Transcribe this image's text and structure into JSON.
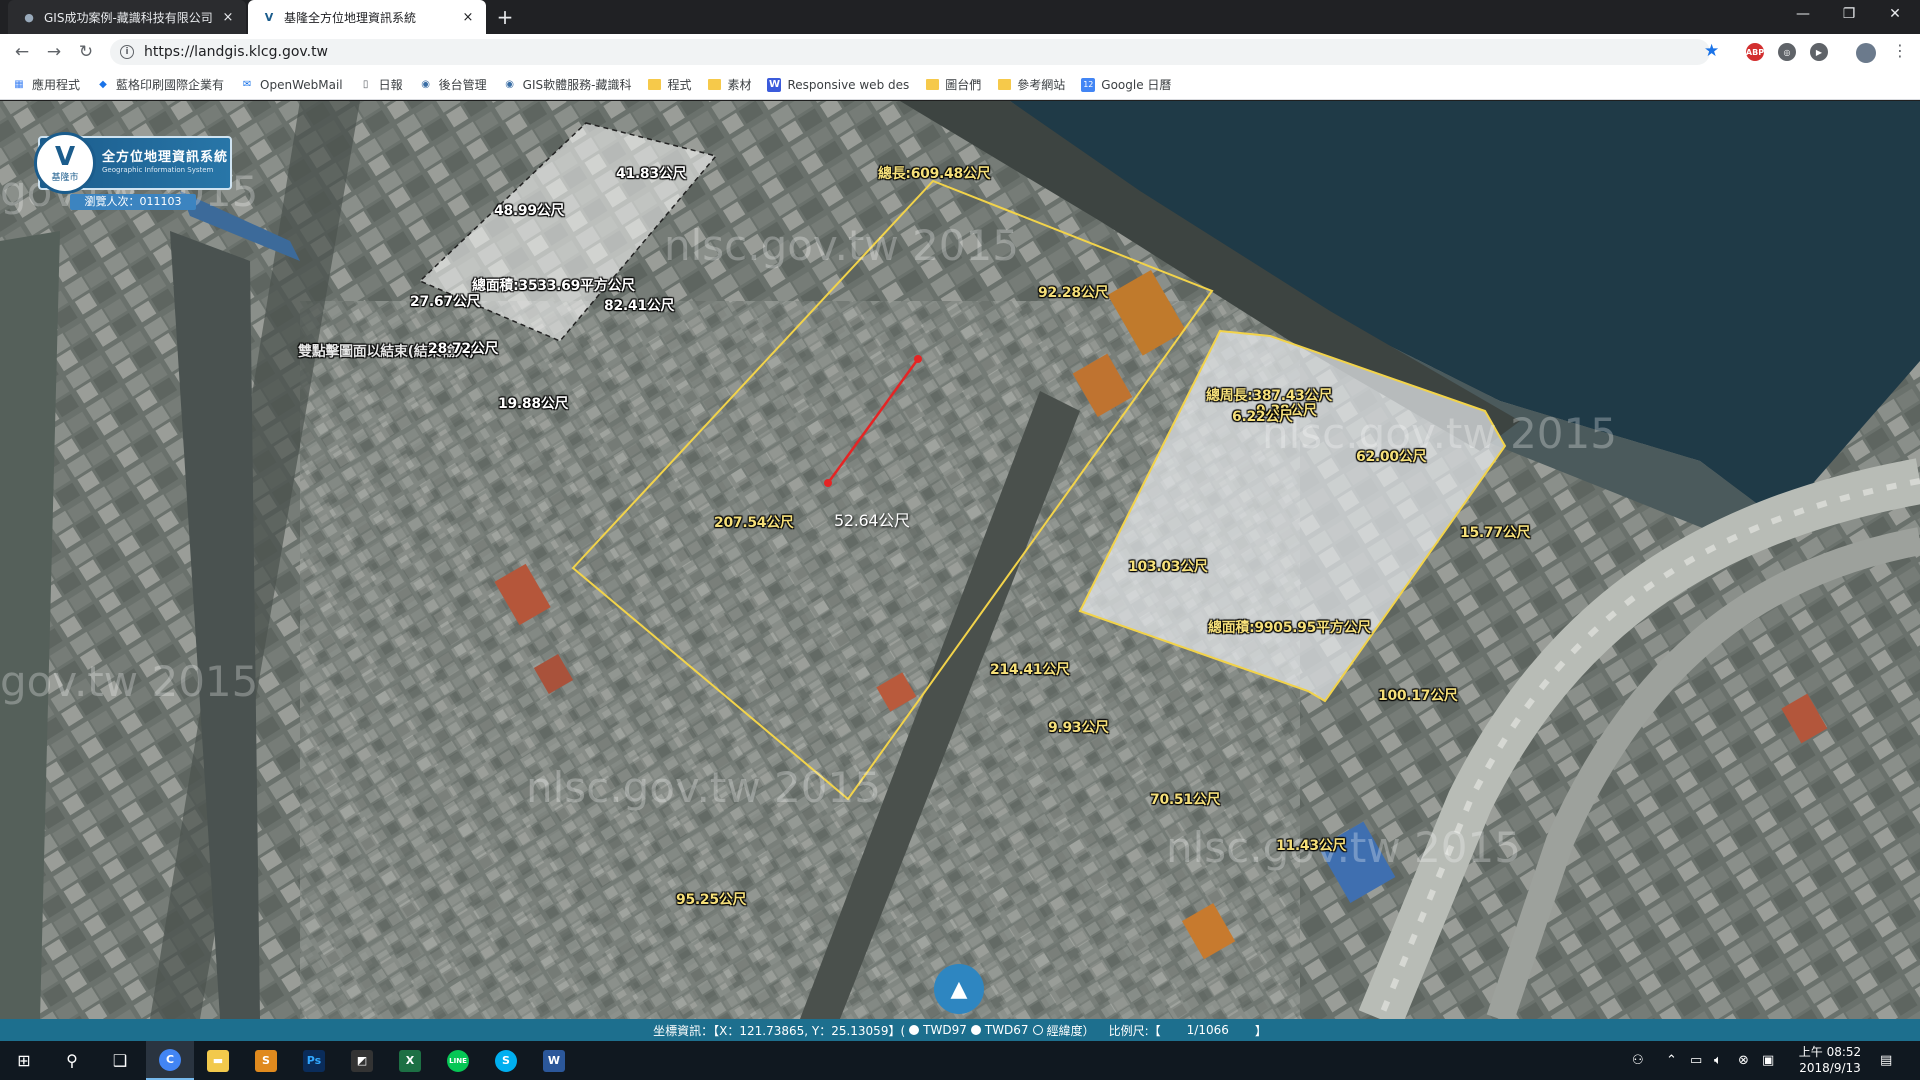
{
  "tabs": [
    {
      "title": "GIS成功案例-藏識科技有限公司",
      "close": "×"
    },
    {
      "title": "基隆全方位地理資訊系統",
      "close": "×"
    }
  ],
  "new_tab": "+",
  "window_controls": {
    "minimize": "—",
    "restore": "❐",
    "close": "✕"
  },
  "address": {
    "url": "https://landgis.klcg.gov.tw"
  },
  "nav": {
    "back": "←",
    "forward": "→",
    "reload": "↻"
  },
  "extensions": [
    {
      "label": "ABP",
      "color": "#d32f2f"
    },
    {
      "label": "◎",
      "color": "#5f6368"
    },
    {
      "label": "▶",
      "color": "#5f6368"
    }
  ],
  "bookmarks": [
    {
      "label": "應用程式",
      "icon": "apps-grid-icon"
    },
    {
      "label": "藍格印刷國際企業有",
      "icon": "site-icon"
    },
    {
      "label": "OpenWebMail",
      "icon": "mail-icon"
    },
    {
      "label": "日報",
      "icon": "page-icon"
    },
    {
      "label": "後台管理",
      "icon": "site-icon"
    },
    {
      "label": "GIS軟體服務-藏識科",
      "icon": "site-icon"
    },
    {
      "label": "程式",
      "icon": "folder-icon"
    },
    {
      "label": "素材",
      "icon": "folder-icon"
    },
    {
      "label": "Responsive web des",
      "icon": "w-icon"
    },
    {
      "label": "圖台們",
      "icon": "folder-icon"
    },
    {
      "label": "參考網站",
      "icon": "folder-icon"
    },
    {
      "label": "Google 日曆",
      "icon": "calendar-icon"
    }
  ],
  "logo": {
    "title": "全方位地理資訊系統",
    "subtitle": "Geographic Information System",
    "city": "基隆市",
    "visitors": "瀏覽人次：011103"
  },
  "watermarks": [
    "gov.tw 2015",
    "nlsc.gov.tw 2015",
    "nlsc.gov.tw 2015",
    "gov.tw 2015",
    "nlsc.gov.tw 2015",
    "nlsc.gov.tw 2015"
  ],
  "measurements": {
    "poly1": {
      "e1": "41.83公尺",
      "e2": "48.99公尺",
      "area": "總面積:3533.69平方公尺",
      "e3": "82.41公尺",
      "e4": "27.67公尺",
      "e5": "28.72公尺",
      "e6": "19.88公尺",
      "hint": "雙點擊圖面以結束(結束輸入)"
    },
    "poly2": {
      "perimeter": "總長:609.48公尺",
      "e1": "92.28公尺",
      "e2": "207.54公尺",
      "e3": "214.41公尺",
      "e4": "95.25公尺"
    },
    "line": {
      "length": "52.64公尺"
    },
    "poly3": {
      "perimeter": "總周長:387.43公尺",
      "e1": "9.38公尺",
      "e2": "6.22公尺",
      "e3": "62.00公尺",
      "e4": "15.77公尺",
      "e5": "103.03公尺",
      "area": "總面積:9905.95平方公尺",
      "e6": "100.17公尺",
      "e7": "9.93公尺",
      "e8": "70.51公尺",
      "e9": "11.43公尺"
    }
  },
  "up_button": "▲",
  "statusbar": {
    "coords": "坐標資訊：【X：121.73865, Y：25.13059】(",
    "opt1": "TWD97",
    "opt2": "TWD67",
    "opt3": "經緯度）",
    "scale_label": "比例尺:【",
    "scale_value": "1/1066",
    "scale_end": "】"
  },
  "taskbar": {
    "apps": [
      {
        "label": "C",
        "color": "#4285f4",
        "icon": "chrome-icon"
      },
      {
        "label": "▬",
        "color": "#f2c94c",
        "icon": "file-explorer-icon"
      },
      {
        "label": "S",
        "color": "#e08a1e",
        "icon": "sublime-icon"
      },
      {
        "label": "Ps",
        "color": "#0a2c5a",
        "icon": "photoshop-icon"
      },
      {
        "label": "◩",
        "color": "#333333",
        "icon": "notes-icon"
      },
      {
        "label": "X",
        "color": "#1d7044",
        "icon": "excel-icon"
      },
      {
        "label": "LINE",
        "color": "#06c755",
        "icon": "line-icon"
      },
      {
        "label": "S",
        "color": "#00aff0",
        "icon": "skype-icon"
      },
      {
        "label": "W",
        "color": "#2b579a",
        "icon": "word-icon"
      }
    ],
    "time": "上午 08:52",
    "date": "2018/9/13"
  }
}
